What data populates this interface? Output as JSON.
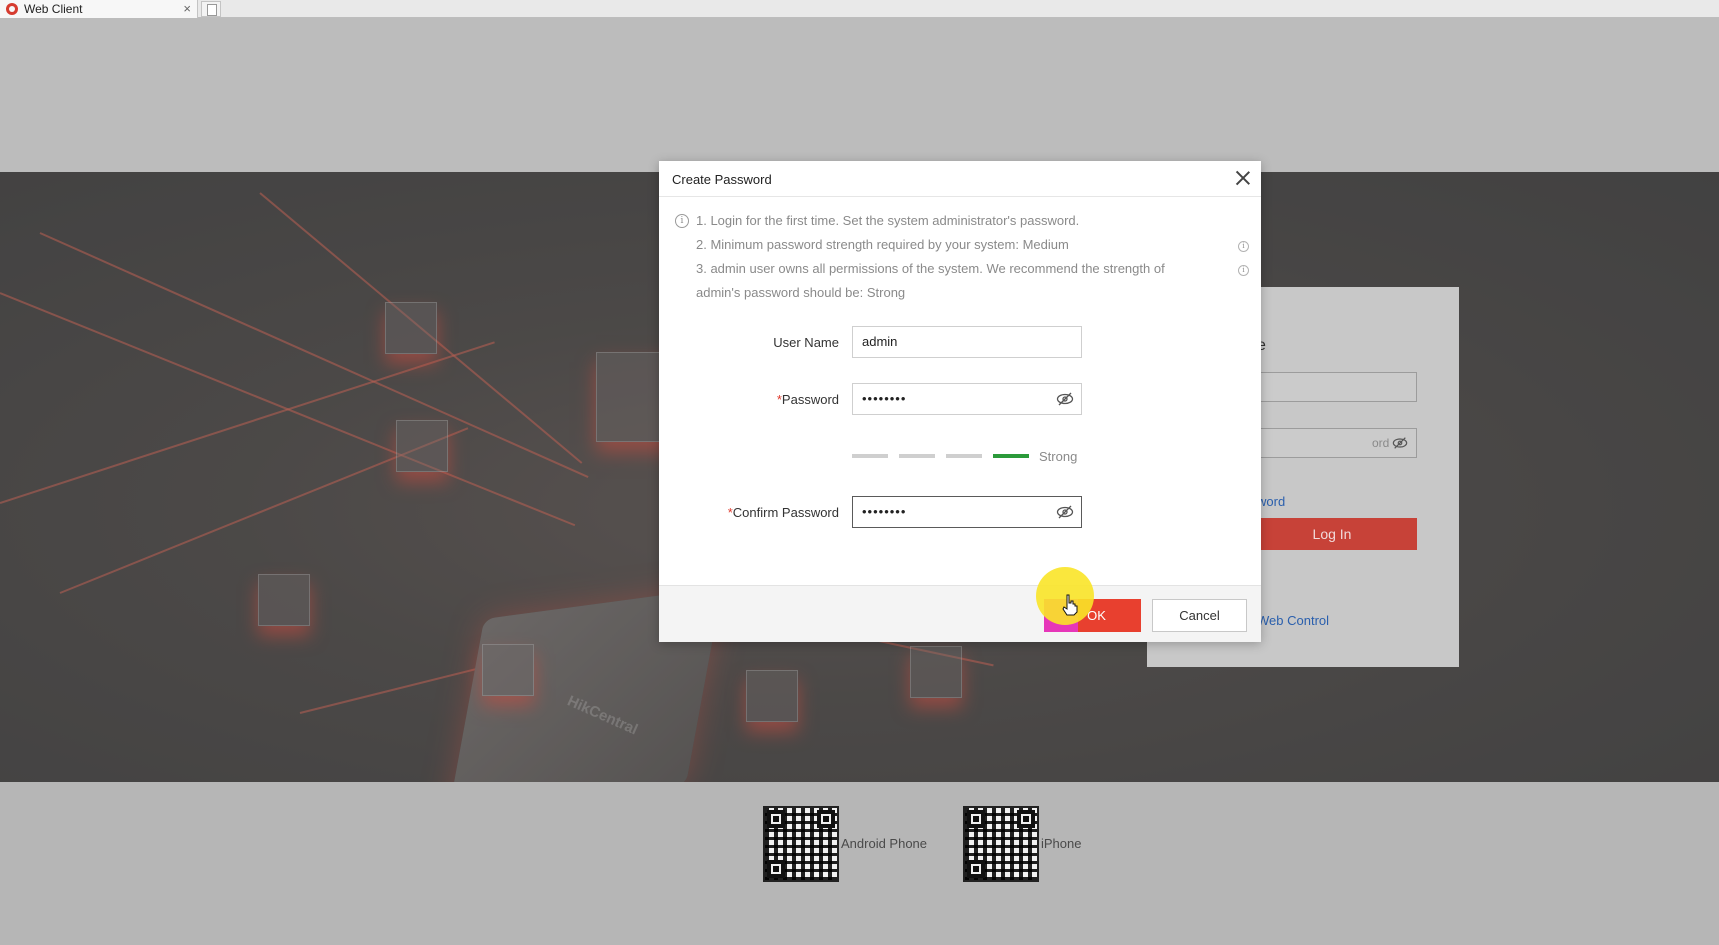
{
  "browser": {
    "tab_title": "Web Client",
    "tab_close": "×"
  },
  "hero": {
    "chip_brand": "HikCentral"
  },
  "login_panel": {
    "title_fragment": "e",
    "password_placeholder_fragment": "ord",
    "forgot_link_fragment": "word",
    "login_button": "Log In",
    "web_control_link_fragment": "Web Control"
  },
  "dialog": {
    "title": "Create Password",
    "notes": [
      "1. Login for the first time. Set the system administrator's password.",
      "2. Minimum password strength required by your system: Medium",
      "3. admin user owns all permissions of the system. We recommend the strength of",
      "admin's password should be: Strong"
    ],
    "fields": {
      "username_label": "User Name",
      "username_value": "admin",
      "required_mark": "*",
      "password_label": "Password",
      "password_value": "••••••••",
      "confirm_label": "Confirm Password",
      "confirm_value": "••••••••"
    },
    "strength": {
      "label": "Strong",
      "level": 4,
      "max": 4,
      "active_color": "#2b9a3a"
    },
    "buttons": {
      "ok": "OK",
      "cancel": "Cancel"
    }
  },
  "qr_codes": [
    {
      "label": "Android Phone"
    },
    {
      "label": "iPhone"
    }
  ],
  "colors": {
    "accent_red": "#e8402f",
    "link_blue": "#2a5fad"
  }
}
